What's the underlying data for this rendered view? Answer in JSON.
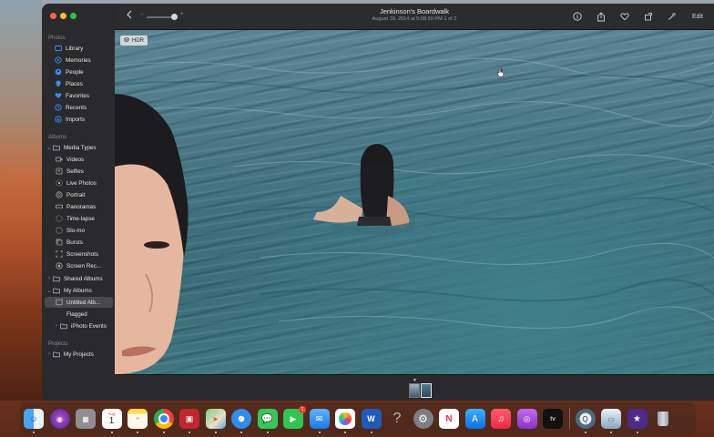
{
  "window": {
    "title": "Jenkinson's Boardwalk",
    "subtitle": "August 18, 2014 at 5:08:50 PM    1 of 2",
    "edit_label": "Edit"
  },
  "sidebar": {
    "section_photos": "Photos",
    "photos_items": [
      {
        "label": "Library",
        "icon": "library-icon"
      },
      {
        "label": "Memories",
        "icon": "memories-icon"
      },
      {
        "label": "People",
        "icon": "people-icon"
      },
      {
        "label": "Places",
        "icon": "places-icon"
      },
      {
        "label": "Favorites",
        "icon": "heart-icon"
      },
      {
        "label": "Recents",
        "icon": "clock-icon"
      },
      {
        "label": "Imports",
        "icon": "import-icon"
      }
    ],
    "section_albums": "Albums",
    "media_types_label": "Media Types",
    "media_items": [
      {
        "label": "Videos"
      },
      {
        "label": "Selfies"
      },
      {
        "label": "Live Photos"
      },
      {
        "label": "Portrait"
      },
      {
        "label": "Panoramas"
      },
      {
        "label": "Time-lapse"
      },
      {
        "label": "Slo-mo"
      },
      {
        "label": "Bursts"
      },
      {
        "label": "Screenshots"
      },
      {
        "label": "Screen Rec..."
      }
    ],
    "shared_albums_label": "Shared Albums",
    "my_albums_label": "My Albums",
    "my_album_items": [
      {
        "label": "Untitled Alb..."
      },
      {
        "label": "Flagged"
      }
    ],
    "iphoto_events_label": "iPhoto Events",
    "section_projects": "Projects",
    "my_projects_label": "My Projects"
  },
  "photo": {
    "hdr_label": "HDR"
  },
  "dock": {
    "apps": [
      "Finder",
      "Siri",
      "Launchpad",
      "Calendar",
      "Notes",
      "Chrome",
      "Photo Booth",
      "Maps",
      "Safari",
      "Messages",
      "FaceTime",
      "Mail",
      "Photos",
      "Word",
      "Help",
      "System Preferences",
      "News",
      "App Store",
      "Music",
      "Podcasts",
      "TV",
      "QuickTime",
      "Preview",
      "iMovie",
      "Trash"
    ],
    "calendar_month": "Aug",
    "calendar_day": "1",
    "facetime_badge": "1",
    "tv_label": "tv"
  }
}
